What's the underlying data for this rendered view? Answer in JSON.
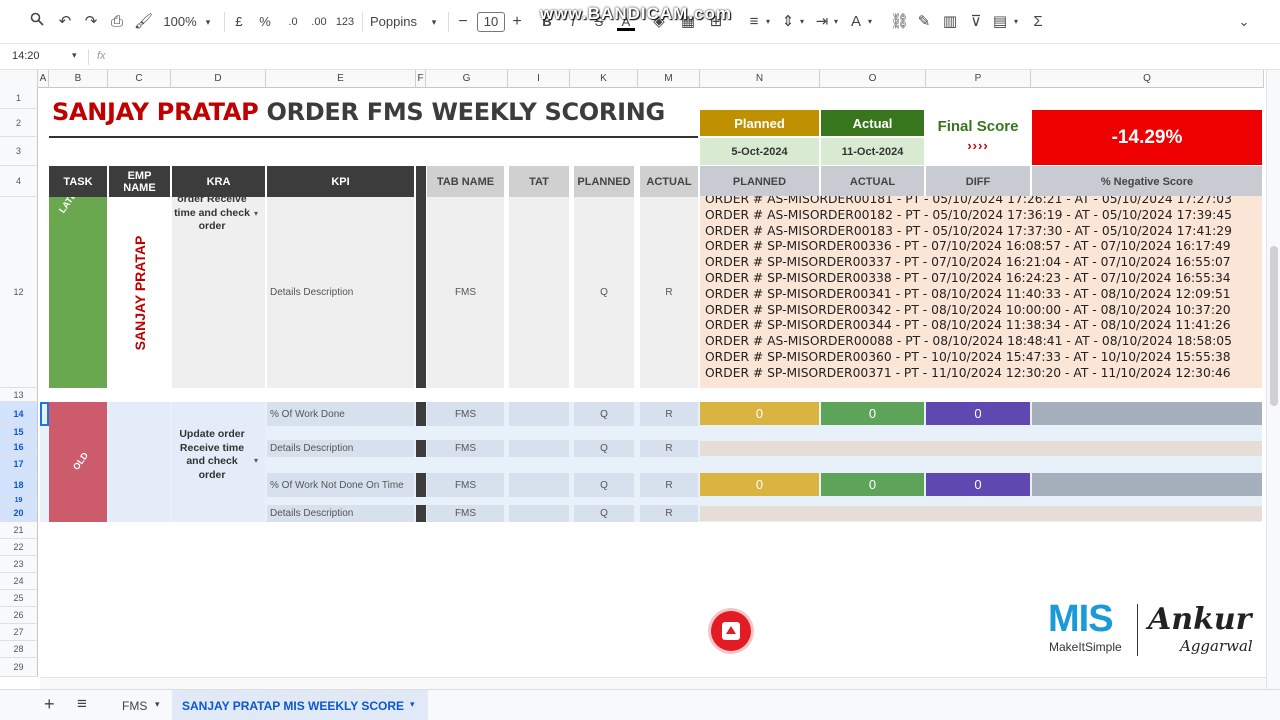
{
  "toolbar": {
    "zoom": "100%",
    "currency": "£",
    "percent": "%",
    "dec_less": ".0",
    "dec_more": ".00",
    "number_format": "123",
    "font": "Poppins",
    "font_size": "10",
    "watermark": "www.BANDICAM.com"
  },
  "formula_bar": {
    "cell_ref": "14:20",
    "fx": "fx"
  },
  "columns": [
    "A",
    "B",
    "C",
    "D",
    "E",
    "F",
    "G",
    "I",
    "K",
    "M",
    "N",
    "O",
    "P",
    "Q"
  ],
  "rows": [
    "1",
    "2",
    "3",
    "4",
    "12",
    "13",
    "14",
    "15",
    "16",
    "17",
    "18",
    "19",
    "20",
    "21",
    "22",
    "23",
    "24",
    "25",
    "26",
    "27",
    "28",
    "29"
  ],
  "title": {
    "part1": "SANJAY PRATAP",
    "part2": " ORDER FMS WEEKLY SCORING"
  },
  "summary": {
    "planned_label": "Planned",
    "actual_label": "Actual",
    "final_score_label": "Final Score",
    "arrows": "››››",
    "planned_date": "5-Oct-2024",
    "actual_date": "11-Oct-2024",
    "final_score_value": "-14.29%"
  },
  "table_headers": {
    "task": "TASK",
    "emp_name": "EMP NAME",
    "kra": "KRA",
    "kpi": "KPI",
    "tab_name": "TAB NAME",
    "tat": "TAT",
    "planned": "PLANNED",
    "actual": "ACTUAL",
    "planned2": "PLANNED",
    "actual2": "ACTUAL",
    "diff": "DIFF",
    "neg_score": "% Negative Score"
  },
  "latest": {
    "task_label": "LATEST",
    "emp_name": "SANJAY PRATAP",
    "kra": "order Receive time and check order",
    "kpi": "Details Description",
    "tab": "FMS",
    "planned": "Q",
    "actual": "R",
    "orders": [
      "ORDER # AS-MISORDER00181 - PT - 05/10/2024 17:26:21 - AT - 05/10/2024 17:27:03",
      "ORDER # AS-MISORDER00182 - PT - 05/10/2024 17:36:19 - AT - 05/10/2024 17:39:45",
      "ORDER # AS-MISORDER00183 - PT - 05/10/2024 17:37:30 - AT - 05/10/2024 17:41:29",
      "ORDER # SP-MISORDER00336 - PT - 07/10/2024 16:08:57 - AT - 07/10/2024 16:17:49",
      "ORDER # SP-MISORDER00337 - PT - 07/10/2024 16:21:04 - AT - 07/10/2024 16:55:07",
      "ORDER # SP-MISORDER00338 - PT - 07/10/2024 16:24:23 - AT - 07/10/2024 16:55:34",
      "ORDER # SP-MISORDER00341 - PT - 08/10/2024 11:40:33 - AT - 08/10/2024 12:09:51",
      "ORDER # SP-MISORDER00342 - PT - 08/10/2024 10:00:00 - AT - 08/10/2024 10:37:20",
      "ORDER # SP-MISORDER00344 - PT - 08/10/2024 11:38:34 - AT - 08/10/2024 11:41:26",
      "ORDER # AS-MISORDER00088 - PT - 08/10/2024 18:48:41 - AT - 08/10/2024 18:58:05",
      "ORDER # SP-MISORDER00360 - PT - 10/10/2024 15:47:33 - AT - 10/10/2024 15:55:38",
      "ORDER # SP-MISORDER00371 - PT - 11/10/2024 12:30:20 - AT - 11/10/2024 12:30:46"
    ]
  },
  "old": {
    "task_label": "OLD",
    "kra": "Update order Receive time and check order",
    "kpi1": "% Of Work Done",
    "kpi2": "Details Description",
    "kpi3": "% Of Work Not Done On Time",
    "kpi4": "Details Description",
    "tab": "FMS",
    "planned": "Q",
    "actual": "R",
    "zero": "0"
  },
  "logo": {
    "brand": "MIS",
    "tagline": "MakeItSimple",
    "sig1": "Ankur",
    "sig2": "Aggarwal"
  },
  "sheet_tabs": {
    "tab1": "FMS",
    "tab2": "SANJAY PRATAP MIS WEEKLY SCORE"
  },
  "colors": {
    "red": "#c00000",
    "green_task": "#6aa84f",
    "red_task": "#cc5c6b",
    "gold": "#bf9000",
    "dark_green": "#38761d",
    "purple": "#674ea7",
    "red_score": "#ee0000"
  }
}
